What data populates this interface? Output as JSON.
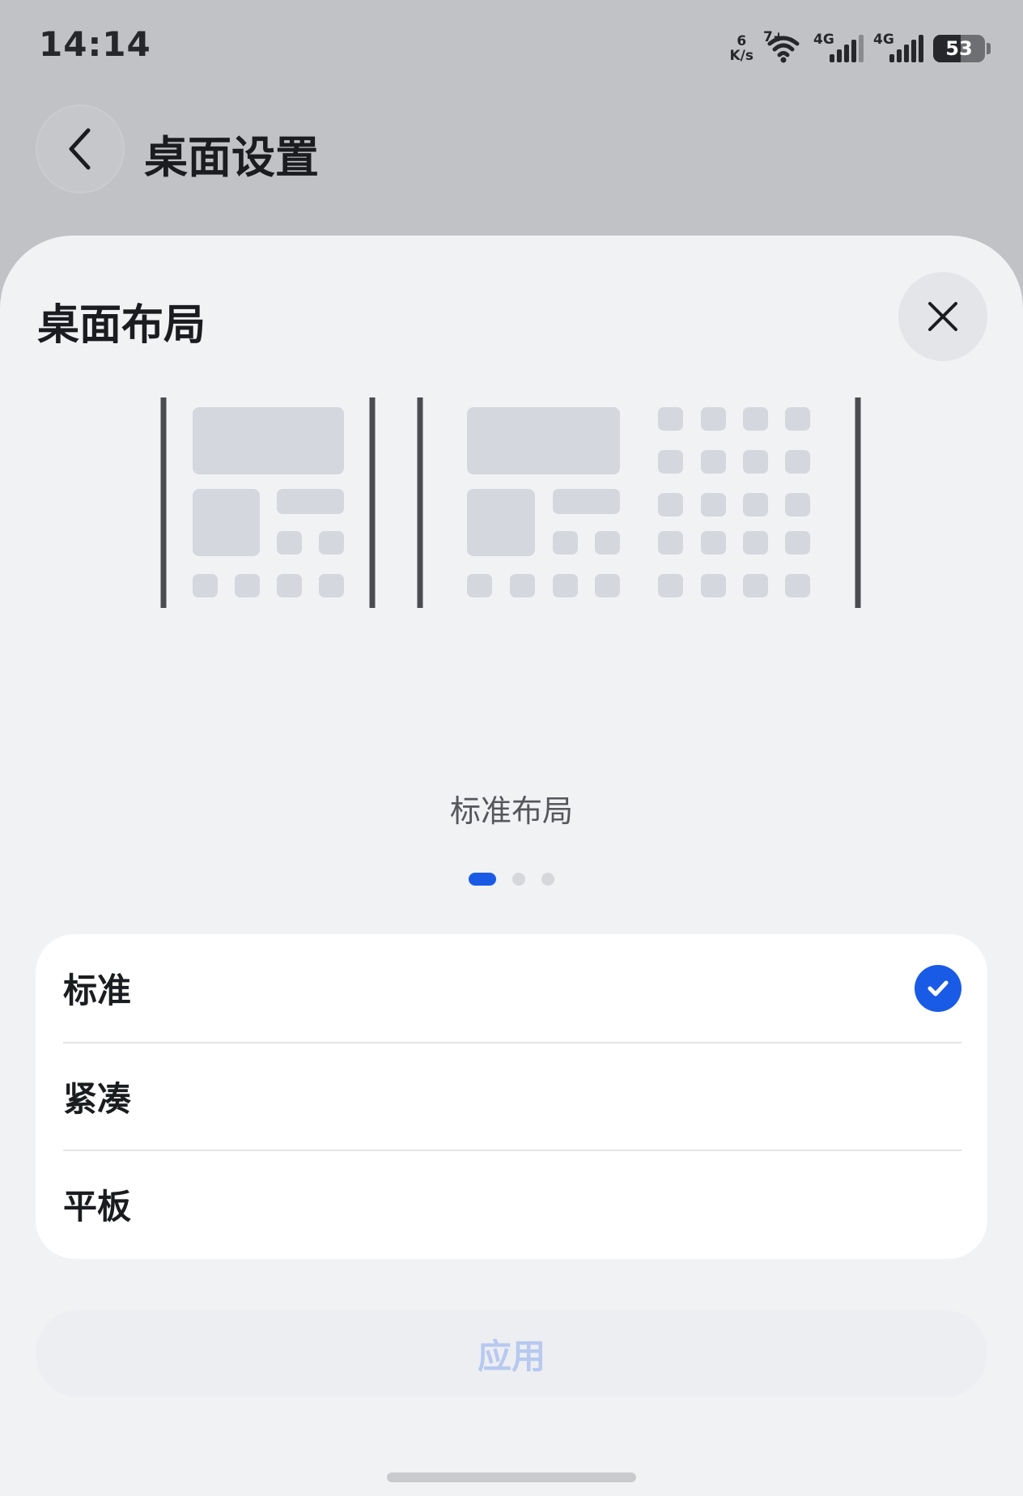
{
  "status_bar": {
    "time": "14:14",
    "net_speed_value": "6",
    "net_speed_unit": "K/s",
    "wifi_label": "7+",
    "sim1_label": "4G",
    "sim2_label": "4G",
    "battery_level": "53"
  },
  "header": {
    "title": "桌面设置"
  },
  "sheet": {
    "title": "桌面布局",
    "preview_caption": "标准布局",
    "pager": {
      "pages": 3,
      "active_index": 0
    },
    "options": [
      {
        "label": "标准",
        "selected": true
      },
      {
        "label": "紧凑",
        "selected": false
      },
      {
        "label": "平板",
        "selected": false
      }
    ],
    "apply_label": "应用"
  },
  "colors": {
    "accent": "#1a5be6",
    "sheet_background": "#f1f2f4",
    "scrim": "#c1c2c5",
    "apply_disabled_text": "#b7c9f0"
  },
  "icons": {
    "back": "chevron-left-icon",
    "close": "close-icon",
    "check": "check-circle-icon",
    "wifi": "wifi-icon",
    "signal": "signal-icon",
    "battery": "battery-icon"
  }
}
